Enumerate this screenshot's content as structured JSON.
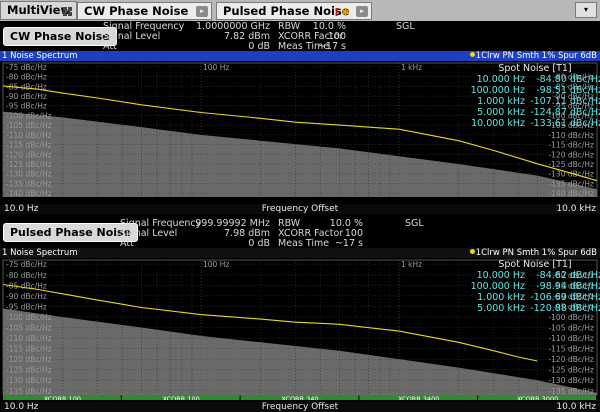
{
  "tabs": {
    "multiview": "MultiView",
    "tab1": "CW Phase Noise",
    "tab2": "Pulsed Phase Noise",
    "arrow": "▸",
    "dropdown": "▾",
    "alert": "!"
  },
  "colors": {
    "trace": "#e8d820",
    "spot": "#5fe6e6",
    "bar": "#2e8b2e",
    "title": "#1e3fbf"
  },
  "channels": [
    {
      "button": "CW Phase Noise",
      "sig_freq_label": "Signal Frequency",
      "sig_freq_value": "1.0000000 GHz",
      "sig_level_label": "Signal Level",
      "sig_level_value": "7.82 dBm",
      "att_label": "Att",
      "att_value": "0 dB",
      "rbw_label": "RBW",
      "rbw_value": "10.0 %",
      "xcorr_label": "XCORR Factor",
      "xcorr_value": "100",
      "meas_label": "Meas Time",
      "meas_value": "~17 s",
      "mode": "SGL",
      "diagram_title": "1 Noise Spectrum",
      "trace_label": "1Clrw PN Smth 1% Spur 6dB",
      "spot_header": "Spot Noise [T1]",
      "spot": [
        {
          "f": "10.000 Hz",
          "v": "-84.80 dBc/Hz"
        },
        {
          "f": "100.000 Hz",
          "v": "-98.51 dBc/Hz"
        },
        {
          "f": "1.000 kHz",
          "v": "-107.11 dBc/Hz"
        },
        {
          "f": "5.000 kHz",
          "v": "-124.87 dBc/Hz"
        },
        {
          "f": "10.000 kHz",
          "v": "-133.61 dBc/Hz"
        }
      ],
      "y_ticks": [
        "-75 dBc/Hz",
        "-80 dBc/Hz",
        "-85 dBc/Hz",
        "-90 dBc/Hz",
        "-95 dBc/Hz",
        "-100 dBc/Hz",
        "-105 dBc/Hz",
        "-110 dBc/Hz",
        "-115 dBc/Hz",
        "-120 dBc/Hz",
        "-125 dBc/Hz",
        "-130 dBc/Hz",
        "-135 dBc/Hz",
        "-140 dBc/Hz"
      ],
      "y_right_ticks": [
        "-80 dBc/Hz",
        "-85 dBc/Hz",
        "-90 dBc/Hz",
        "-95 dBc/Hz",
        "-100 dBc/Hz",
        "-105 dBc/Hz",
        "-110 dBc/Hz",
        "-115 dBc/Hz",
        "-120 dBc/Hz",
        "-125 dBc/Hz",
        "-130 dBc/Hz",
        "-135 dBc/Hz",
        "-140 dBc/Hz"
      ],
      "x_top_labels": [
        "100 Hz",
        "1 kHz"
      ],
      "xcorr_segments": [
        "XCORR 100",
        "XCORR 100",
        "XCORR 340",
        "XCORR 300",
        "XCORR 300"
      ],
      "x_left": "10.0 Hz",
      "x_center": "Frequency Offset",
      "x_right": "10.0 kHz"
    },
    {
      "button": "Pulsed Phase Noise",
      "sig_freq_label": "Signal Frequency",
      "sig_freq_value": "999.99992 MHz",
      "sig_level_label": "Signal Level",
      "sig_level_value": "7.98 dBm",
      "att_label": "Att",
      "att_value": "0 dB",
      "rbw_label": "RBW",
      "rbw_value": "10.0 %",
      "xcorr_label": "XCORR Factor",
      "xcorr_value": "100",
      "meas_label": "Meas Time",
      "meas_value": "~17 s",
      "mode": "SGL",
      "diagram_title": "1 Noise Spectrum",
      "trace_label": "1Clrw PN Smth 1% Spur 6dB",
      "spot_header": "Spot Noise [T1]",
      "spot": [
        {
          "f": "10.000 Hz",
          "v": "-84.62 dBc/Hz"
        },
        {
          "f": "100.000 Hz",
          "v": "-98.94 dBc/Hz"
        },
        {
          "f": "1.000 kHz",
          "v": "-106.69 dBc/Hz"
        },
        {
          "f": "5.000 kHz",
          "v": "-120.88 dBc/Hz"
        }
      ],
      "y_ticks": [
        "-75 dBc/Hz",
        "-80 dBc/Hz",
        "-85 dBc/Hz",
        "-90 dBc/Hz",
        "-95 dBc/Hz",
        "-100 dBc/Hz",
        "-105 dBc/Hz",
        "-110 dBc/Hz",
        "-115 dBc/Hz",
        "-120 dBc/Hz",
        "-125 dBc/Hz",
        "-130 dBc/Hz",
        "-135 dBc/Hz"
      ],
      "y_right_ticks": [
        "-80 dBc/Hz",
        "-85 dBc/Hz",
        "-90 dBc/Hz",
        "-95 dBc/Hz",
        "-100 dBc/Hz",
        "-105 dBc/Hz",
        "-110 dBc/Hz",
        "-115 dBc/Hz",
        "-120 dBc/Hz",
        "-125 dBc/Hz",
        "-130 dBc/Hz",
        "-135 dBc/Hz"
      ],
      "x_top_labels": [
        "100 Hz",
        "1 kHz"
      ],
      "xcorr_segments": [
        "XCORR 100",
        "XCORR 100",
        "XCORR 340",
        "XCORR 3400",
        "XCORR 3000"
      ],
      "x_left": "10.0 Hz",
      "x_center": "Frequency Offset",
      "x_right": "10.0 kHz"
    }
  ],
  "chart_data": [
    {
      "type": "line",
      "x_scale": "log",
      "xlabel": "Frequency Offset",
      "xlim": [
        10,
        10000
      ],
      "ylim": [
        -142,
        -73
      ],
      "series": [
        {
          "name": "1Clrw PN Smth 1% Spur 6dB",
          "x": [
            10,
            15,
            20,
            30,
            50,
            100,
            200,
            300,
            500,
            1000,
            2000,
            3000,
            5000,
            7000,
            10000
          ],
          "y": [
            -84.8,
            -86.5,
            -88.5,
            -91,
            -94.5,
            -98.5,
            -101.5,
            -103.5,
            -105,
            -107.1,
            -113,
            -118,
            -124.9,
            -129,
            -133.6
          ]
        }
      ],
      "floor": {
        "x": [
          10,
          20,
          50,
          100,
          200,
          500,
          1000,
          2000,
          5000,
          10000
        ],
        "y": [
          -98,
          -101,
          -106,
          -110,
          -113,
          -117,
          -121,
          -125,
          -131,
          -138
        ]
      }
    },
    {
      "type": "line",
      "x_scale": "log",
      "xlabel": "Frequency Offset",
      "xlim": [
        10,
        10000
      ],
      "ylim": [
        -137,
        -73
      ],
      "series": [
        {
          "name": "1Clrw PN Smth 1% Spur 6dB",
          "x": [
            10,
            15,
            20,
            30,
            50,
            100,
            200,
            300,
            400,
            500,
            1000,
            2000,
            3000,
            4000,
            5000
          ],
          "y": [
            -84.6,
            -87,
            -89,
            -92,
            -95.5,
            -98.9,
            -101,
            -102.5,
            -103,
            -103.5,
            -106.7,
            -112,
            -116,
            -119,
            -120.9
          ]
        }
      ],
      "floor": {
        "x": [
          10,
          20,
          50,
          100,
          200,
          500,
          1000,
          2000,
          5000,
          10000
        ],
        "y": [
          -96,
          -100,
          -105,
          -109,
          -112,
          -116,
          -120,
          -124,
          -130,
          -136
        ]
      }
    }
  ]
}
